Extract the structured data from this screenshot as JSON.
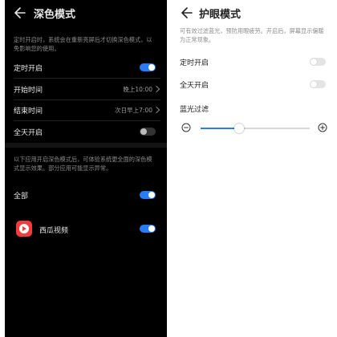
{
  "dark_mode": {
    "title": "深色模式",
    "description": "定时开启时，系统会在重新亮屏后才切换深色模式，以免影响您的使用。",
    "scheduled": {
      "label": "定时开启",
      "on": true
    },
    "start_time": {
      "label": "开始时间",
      "value": "晚上10:00"
    },
    "end_time": {
      "label": "结束时间",
      "value": "次日早上7:00"
    },
    "all_day": {
      "label": "全天开启",
      "on": false
    },
    "apps_description": "以下应用开启深色模式后，可体验系统更全面的深色模式显示效果。部分应用可能显示异常。",
    "all_apps": {
      "label": "全部",
      "on": true
    },
    "app": {
      "name": "西瓜视频",
      "on": true
    },
    "colors": {
      "accent": "#2a7cf6",
      "background": "#000000",
      "app_icon": "#f23b3b"
    }
  },
  "eye_comfort": {
    "title": "护眼模式",
    "description": "可有效过滤蓝光，预防用眼疲劳。开启后，屏幕显示偏暖为正常现象。",
    "scheduled": {
      "label": "定时开启",
      "on": false
    },
    "all_day": {
      "label": "全天开启",
      "on": false
    },
    "blue_light_filter": {
      "label": "蓝光过滤",
      "level": 0.35
    },
    "icons": {
      "minus": "minus-circle-icon",
      "plus": "plus-circle-icon",
      "back": "back-arrow-icon"
    }
  }
}
